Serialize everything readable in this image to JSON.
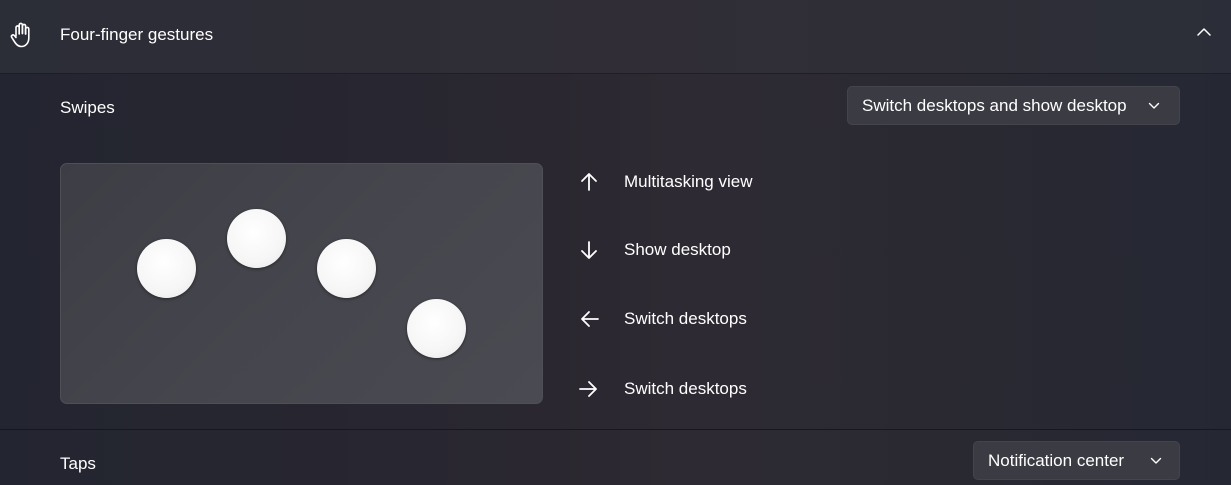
{
  "section": {
    "title": "Four-finger gestures",
    "icon": "hand-icon",
    "expanded": true
  },
  "swipes": {
    "label": "Swipes",
    "selected": "Switch desktops and show desktop",
    "gestures": [
      {
        "direction": "up",
        "icon": "arrow-up-icon",
        "action": "Multitasking view"
      },
      {
        "direction": "down",
        "icon": "arrow-down-icon",
        "action": "Show desktop"
      },
      {
        "direction": "left",
        "icon": "arrow-left-icon",
        "action": "Switch desktops"
      },
      {
        "direction": "right",
        "icon": "arrow-right-icon",
        "action": "Switch desktops"
      }
    ]
  },
  "taps": {
    "label": "Taps",
    "selected": "Notification center"
  },
  "colors": {
    "text": "#ffffff",
    "dropdown_bg": "#3a3b43",
    "touchpad_bg": "#45464d",
    "finger": "#ffffff"
  }
}
